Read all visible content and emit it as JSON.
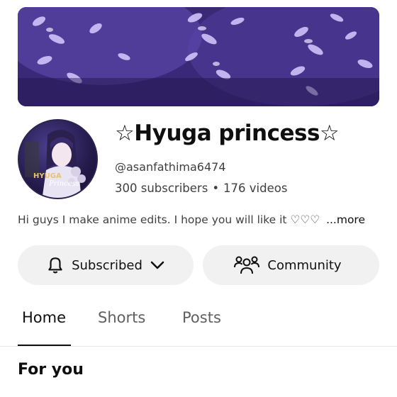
{
  "channel": {
    "name": "☆Hyuga princess☆",
    "handle": "@asanfathima6474",
    "subscribers": "300 subscribers",
    "separator": "•",
    "videos": "176 videos",
    "description": "Hi guys I make anime edits.  I hope you will like it ♡♡♡",
    "more_label": "...more",
    "avatar_text_line1": "HYUGA",
    "avatar_text_line2": "Princess"
  },
  "actions": {
    "subscribed_label": "Subscribed",
    "community_label": "Community"
  },
  "tabs": [
    {
      "label": "Home",
      "active": true
    },
    {
      "label": "Shorts",
      "active": false
    },
    {
      "label": "Posts",
      "active": false
    }
  ],
  "section": {
    "title": "For you"
  },
  "colors": {
    "banner": "#4a3590",
    "button_bg": "#f1f1f1",
    "text": "#0f0f0f",
    "secondary_text": "#606060"
  },
  "icons": {
    "subscribed": "bell-icon",
    "dropdown": "chevron-down-icon",
    "community": "people-icon"
  }
}
